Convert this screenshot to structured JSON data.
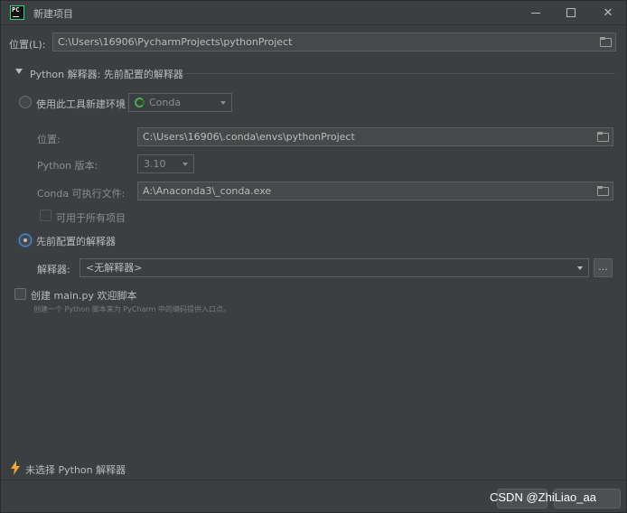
{
  "window": {
    "title": "新建项目"
  },
  "location": {
    "label": "位置(L):",
    "value": "C:\\Users\\16906\\PycharmProjects\\pythonProject"
  },
  "interpreter_section": {
    "title": "Python 解释器: 先前配置的解释器"
  },
  "new_env": {
    "radio_label": "使用此工具新建环境",
    "tool_selected": "Conda",
    "location_label": "位置:",
    "location_value": "C:\\Users\\16906\\.conda\\envs\\pythonProject",
    "python_version_label": "Python 版本:",
    "python_version_value": "3.10",
    "conda_exec_label": "Conda 可执行文件:",
    "conda_exec_value": "A:\\Anaconda3\\_conda.exe",
    "all_projects_label": "可用于所有项目"
  },
  "existing": {
    "radio_label": "先前配置的解释器",
    "interpreter_label": "解释器:",
    "interpreter_value": "<无解释器>",
    "browse_label": "..."
  },
  "main_py": {
    "checkbox_label": "创建 main.py 欢迎脚本",
    "hint": "创建一个 Python 脚本来为 PyCharm 中的编码提供入口点。"
  },
  "status": {
    "warning": "未选择 Python 解释器"
  },
  "watermark": "CSDN @ZhiLiao_aa",
  "colors": {
    "background": "#3c3f41",
    "accent": "#3d8ee4",
    "conda": "#43b047",
    "warning": "#f0a732"
  }
}
